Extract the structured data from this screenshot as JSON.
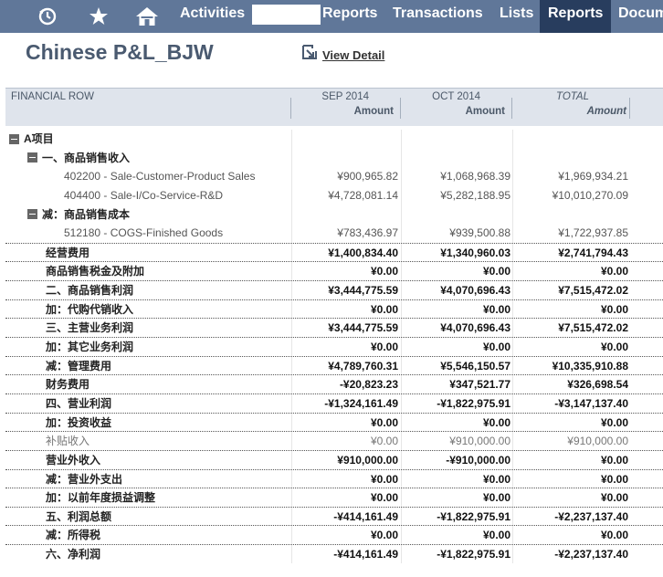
{
  "nav": {
    "items": [
      {
        "label": "Activities",
        "active": false
      },
      {
        "label": "Reports",
        "active": false
      },
      {
        "label": "Transactions",
        "active": false
      },
      {
        "label": "Lists",
        "active": false
      },
      {
        "label": "Reports",
        "active": true
      },
      {
        "label": "Docum",
        "active": false
      }
    ],
    "icons": [
      "recent-icon",
      "star-icon",
      "home-icon"
    ]
  },
  "page": {
    "title": "Chinese P&L_BJW",
    "view_detail": "View Detail"
  },
  "report": {
    "columns": {
      "row": "FINANCIAL ROW",
      "c1": "SEP 2014",
      "c2": "OCT 2014",
      "c3": "TOTAL",
      "sub": "Amount"
    },
    "rows": [
      {
        "label": "A项目",
        "type": "section",
        "indent": 0,
        "toggle": true
      },
      {
        "label": "一、商品销售收入",
        "type": "section",
        "indent": 1,
        "toggle": true
      },
      {
        "label": "402200 - Sale-Customer-Product Sales",
        "type": "detail",
        "indent": 2,
        "sep": "¥900,965.82",
        "oct": "¥1,068,968.39",
        "total": "¥1,969,934.21"
      },
      {
        "label": "404400 - Sale-I/Co-Service-R&D",
        "type": "detail",
        "indent": 2,
        "sep": "¥4,728,081.14",
        "oct": "¥5,282,188.95",
        "total": "¥10,010,270.09"
      },
      {
        "label": "减：商品销售成本",
        "type": "section",
        "indent": 1,
        "toggle": true
      },
      {
        "label": "512180 - COGS-Finished Goods",
        "type": "detail",
        "indent": 2,
        "sep": "¥783,436.97",
        "oct": "¥939,500.88",
        "total": "¥1,722,937.85"
      },
      {
        "label": "经营费用",
        "type": "bold",
        "indent": 1,
        "line": true,
        "sep": "¥1,400,834.40",
        "oct": "¥1,340,960.03",
        "total": "¥2,741,794.43"
      },
      {
        "label": "商品销售税金及附加",
        "type": "bold",
        "indent": 1,
        "line": true,
        "sep": "¥0.00",
        "oct": "¥0.00",
        "total": "¥0.00"
      },
      {
        "label": "二、商品销售利润",
        "type": "bold",
        "indent": 1,
        "line": true,
        "sep": "¥3,444,775.59",
        "oct": "¥4,070,696.43",
        "total": "¥7,515,472.02"
      },
      {
        "label": "加：代购代销收入",
        "type": "bold",
        "indent": 1,
        "line": true,
        "sep": "¥0.00",
        "oct": "¥0.00",
        "total": "¥0.00"
      },
      {
        "label": "三、主营业务利润",
        "type": "bold",
        "indent": 1,
        "line": true,
        "sep": "¥3,444,775.59",
        "oct": "¥4,070,696.43",
        "total": "¥7,515,472.02"
      },
      {
        "label": "加：其它业务利润",
        "type": "bold",
        "indent": 1,
        "line": true,
        "sep": "¥0.00",
        "oct": "¥0.00",
        "total": "¥0.00"
      },
      {
        "label": "减：管理费用",
        "type": "bold",
        "indent": 1,
        "line": true,
        "sep": "¥4,789,760.31",
        "oct": "¥5,546,150.57",
        "total": "¥10,335,910.88"
      },
      {
        "label": "财务费用",
        "type": "bold",
        "indent": 1,
        "line": true,
        "sep": "-¥20,823.23",
        "oct": "¥347,521.77",
        "total": "¥326,698.54"
      },
      {
        "label": "四、营业利润",
        "type": "bold",
        "indent": 1,
        "line": true,
        "sep": "-¥1,324,161.49",
        "oct": "-¥1,822,975.91",
        "total": "-¥3,147,137.40"
      },
      {
        "label": "加：投资收益",
        "type": "bold",
        "indent": 1,
        "line": true,
        "sep": "¥0.00",
        "oct": "¥0.00",
        "total": "¥0.00"
      },
      {
        "label": "补贴收入",
        "type": "grey",
        "indent": 1,
        "line": true,
        "sep": "¥0.00",
        "oct": "¥910,000.00",
        "total": "¥910,000.00"
      },
      {
        "label": "营业外收入",
        "type": "bold",
        "indent": 1,
        "line": true,
        "sep": "¥910,000.00",
        "oct": "-¥910,000.00",
        "total": "¥0.00"
      },
      {
        "label": "减：营业外支出",
        "type": "bold",
        "indent": 1,
        "line": true,
        "sep": "¥0.00",
        "oct": "¥0.00",
        "total": "¥0.00"
      },
      {
        "label": "加：以前年度损益调整",
        "type": "bold",
        "indent": 1,
        "line": true,
        "sep": "¥0.00",
        "oct": "¥0.00",
        "total": "¥0.00"
      },
      {
        "label": "五、利润总额",
        "type": "bold",
        "indent": 1,
        "line": true,
        "sep": "-¥414,161.49",
        "oct": "-¥1,822,975.91",
        "total": "-¥2,237,137.40"
      },
      {
        "label": "减：所得税",
        "type": "bold",
        "indent": 1,
        "line": true,
        "sep": "¥0.00",
        "oct": "¥0.00",
        "total": "¥0.00"
      },
      {
        "label": "六、净利润",
        "type": "bold",
        "indent": 1,
        "line": true,
        "sep": "-¥414,161.49",
        "oct": "-¥1,822,975.91",
        "total": "-¥2,237,137.40"
      }
    ]
  }
}
